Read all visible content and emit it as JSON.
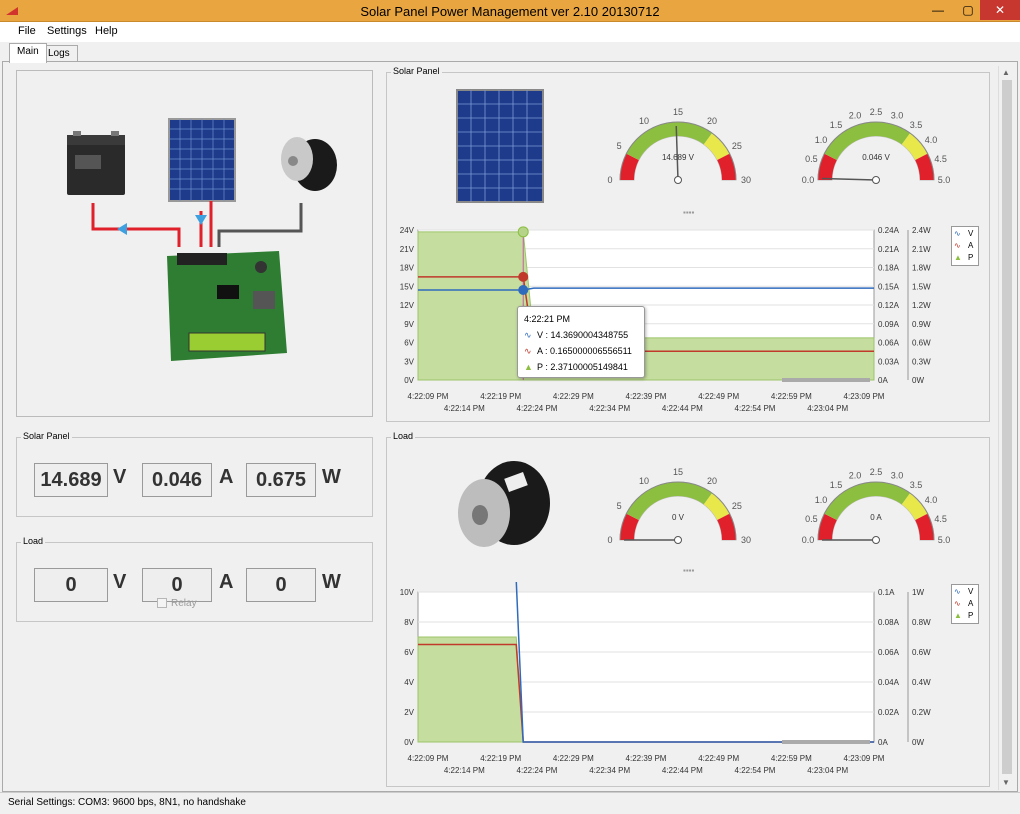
{
  "window": {
    "title": "Solar Panel Power Management ver 2.10 20130712",
    "min_glyph": "—",
    "max_glyph": "▢",
    "close_glyph": "✕"
  },
  "menu": {
    "items": [
      "File",
      "Settings",
      "Help"
    ]
  },
  "tabs": [
    "Main",
    "Logs"
  ],
  "left": {
    "solar_group_label": "Solar Panel",
    "solar_voltage": "14.689",
    "solar_current": "0.046",
    "solar_power": "0.675",
    "load_group_label": "Load",
    "load_voltage": "0",
    "load_current": "0",
    "load_power": "0",
    "unit_v": "V",
    "unit_a": "A",
    "unit_w": "W",
    "relay_label": "Relay"
  },
  "solar": {
    "group_label": "Solar Panel",
    "gauge_voltage": {
      "readout": "14.689 V",
      "ticks": [
        "0",
        "5",
        "10",
        "15",
        "20",
        "25",
        "30"
      ],
      "value": 14.689
    },
    "gauge_current": {
      "readout": "0.046 V",
      "ticks": [
        "0.0",
        "0.5",
        "1.0",
        "1.5",
        "2.0",
        "2.5",
        "3.0",
        "3.5",
        "4.0",
        "4.5",
        "5.0"
      ],
      "value": 0.046
    },
    "tooltip": {
      "time": "4:22:21 PM",
      "v": "V : 14.3690004348755",
      "a": "A : 0.165000006556511",
      "p": "P : 2.37100005149841"
    }
  },
  "load": {
    "group_label": "Load",
    "gauge_voltage": {
      "readout": "0 V",
      "ticks": [
        "0",
        "5",
        "10",
        "15",
        "20",
        "25",
        "30"
      ],
      "value": 0
    },
    "gauge_current": {
      "readout": "0 A",
      "ticks": [
        "0.0",
        "0.5",
        "1.0",
        "1.5",
        "2.0",
        "2.5",
        "3.0",
        "3.5",
        "4.0",
        "4.5",
        "5.0"
      ],
      "value": 0
    }
  },
  "legend": [
    "V",
    "A",
    "P"
  ],
  "status": {
    "text": "Serial Settings:  COM3: 9600 bps, 8N1, no handshake"
  },
  "colors": {
    "voltage": "#2f6bbd",
    "current": "#c0392b",
    "power_fill": "#c5dd9e",
    "gauge_green": "#8cbf3f",
    "gauge_yellow": "#e8e84a",
    "gauge_red": "#e0202a"
  },
  "chart_data": [
    {
      "type": "line",
      "title": "",
      "x_ticks_top": [
        "4:22:09 PM",
        "4:22:19 PM",
        "4:22:29 PM",
        "4:22:39 PM",
        "4:22:49 PM",
        "4:22:59 PM",
        "4:23:09 PM"
      ],
      "x_ticks_bottom": [
        "4:22:14 PM",
        "4:22:24 PM",
        "4:22:34 PM",
        "4:22:44 PM",
        "4:22:54 PM",
        "4:23:04 PM"
      ],
      "y_left_ticks": [
        "24V",
        "21V",
        "18V",
        "15V",
        "12V",
        "9V",
        "6V",
        "3V",
        "0V"
      ],
      "y_mid_ticks": [
        "0.24A",
        "0.21A",
        "0.18A",
        "0.15A",
        "0.12A",
        "0.09A",
        "0.06A",
        "0.03A",
        "0A"
      ],
      "y_right_ticks": [
        "2.4W",
        "2.1W",
        "1.8W",
        "1.5W",
        "1.2W",
        "0.9W",
        "0.6W",
        "0.3W",
        "0W"
      ],
      "ylim_v": [
        0,
        24
      ],
      "ylim_a": [
        0,
        0.24
      ],
      "ylim_w": [
        0,
        2.4
      ],
      "x": [
        0,
        15,
        16.5,
        25,
        35,
        45,
        55,
        65
      ],
      "series": [
        {
          "name": "V",
          "values": [
            14.4,
            14.4,
            14.7,
            14.7,
            14.7,
            14.7,
            14.7,
            14.7
          ]
        },
        {
          "name": "A",
          "values": [
            0.165,
            0.165,
            0.048,
            0.046,
            0.046,
            0.046,
            0.046,
            0.046
          ]
        },
        {
          "name": "P",
          "values": [
            2.371,
            2.371,
            0.68,
            0.675,
            0.675,
            0.675,
            0.675,
            0.675
          ]
        }
      ]
    },
    {
      "type": "line",
      "title": "",
      "x_ticks_top": [
        "4:22:09 PM",
        "4:22:19 PM",
        "4:22:29 PM",
        "4:22:39 PM",
        "4:22:49 PM",
        "4:22:59 PM",
        "4:23:09 PM"
      ],
      "x_ticks_bottom": [
        "4:22:14 PM",
        "4:22:24 PM",
        "4:22:34 PM",
        "4:22:44 PM",
        "4:22:54 PM",
        "4:23:04 PM"
      ],
      "y_left_ticks": [
        "10V",
        "8V",
        "6V",
        "4V",
        "2V",
        "0V"
      ],
      "y_mid_ticks": [
        "0.1A",
        "0.08A",
        "0.06A",
        "0.04A",
        "0.02A",
        "0A"
      ],
      "y_right_ticks": [
        "1W",
        "0.8W",
        "0.6W",
        "0.4W",
        "0.2W",
        "0W"
      ],
      "ylim_v": [
        0,
        10
      ],
      "ylim_a": [
        0,
        0.1
      ],
      "ylim_w": [
        0,
        1
      ],
      "x": [
        0,
        14,
        15,
        65
      ],
      "series": [
        {
          "name": "V",
          "values": [
            10.8,
            10.8,
            0,
            0
          ]
        },
        {
          "name": "A",
          "values": [
            0.065,
            0.065,
            0,
            0
          ]
        },
        {
          "name": "P",
          "values": [
            0.7,
            0.7,
            0,
            0
          ]
        }
      ]
    }
  ]
}
